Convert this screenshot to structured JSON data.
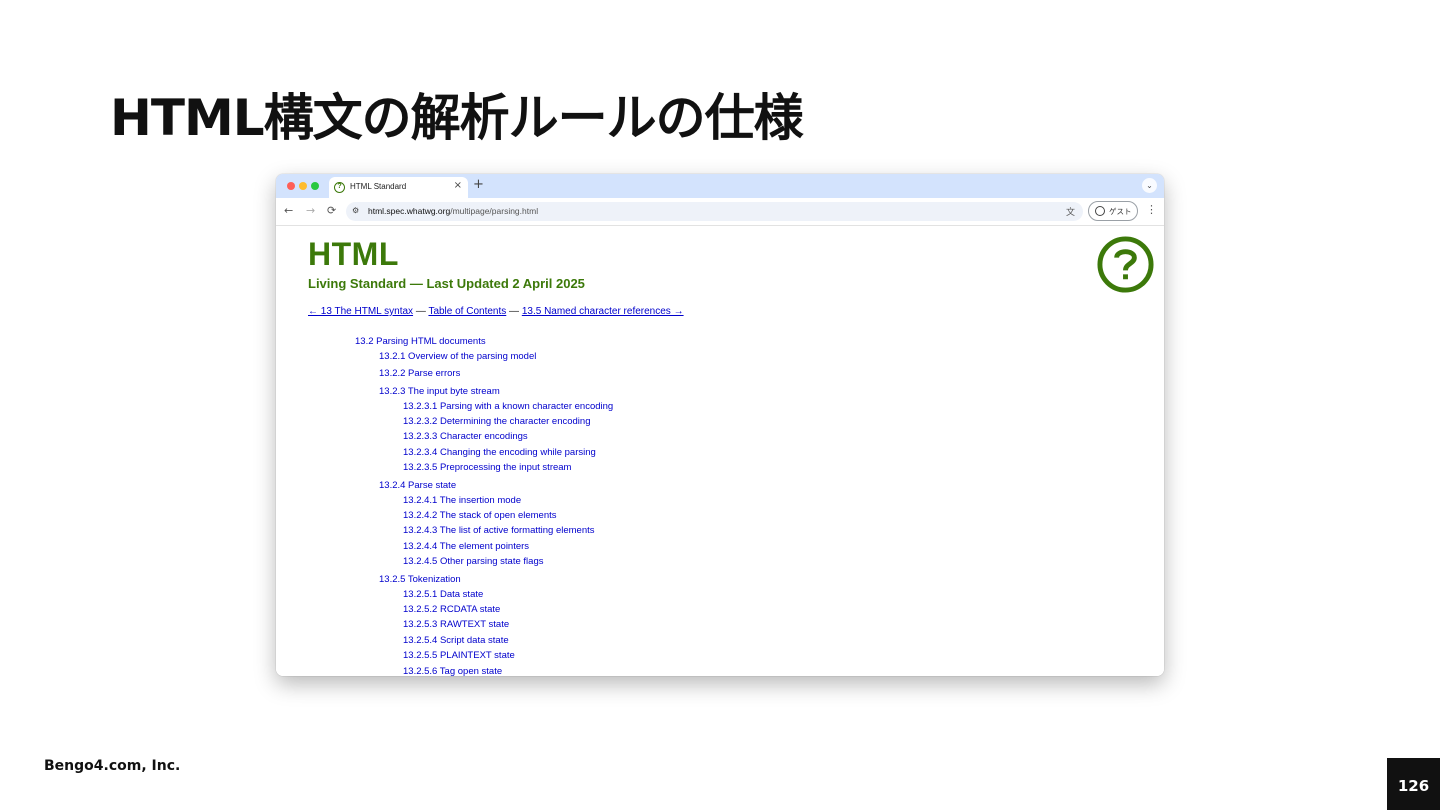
{
  "slide": {
    "title": "HTML構文の解析ルールの仕様",
    "footer": "Bengo4.com, Inc.",
    "page_number": "126"
  },
  "browser": {
    "tab_title": "HTML Standard",
    "tab_close": "×",
    "new_tab": "+",
    "tab_search_icon": "chevron-down-icon",
    "nav_back": "←",
    "nav_forward": "→",
    "nav_reload": "C",
    "site_info": "⚙",
    "url_host": "html.spec.whatwg.org",
    "url_path": "/multipage/parsing.html",
    "translate_icon": "文",
    "profile_label": "ゲスト",
    "menu": "⋮"
  },
  "page": {
    "title": "HTML",
    "subtitle": "Living Standard — Last Updated 2 April 2025",
    "breadcrumb": {
      "prev": "← 13 The HTML syntax",
      "sep1": " — ",
      "toc": "Table of Contents",
      "sep2": " — ",
      "next": "13.5 Named character references →"
    },
    "toc": [
      {
        "level": 0,
        "label": "13.2 Parsing HTML documents"
      },
      {
        "level": 1,
        "label": "13.2.1 Overview of the parsing model"
      },
      {
        "level": 1,
        "label": "13.2.2 Parse errors"
      },
      {
        "level": 1,
        "label": "13.2.3 The input byte stream"
      },
      {
        "level": 2,
        "label": "13.2.3.1 Parsing with a known character encoding"
      },
      {
        "level": 2,
        "label": "13.2.3.2 Determining the character encoding"
      },
      {
        "level": 2,
        "label": "13.2.3.3 Character encodings"
      },
      {
        "level": 2,
        "label": "13.2.3.4 Changing the encoding while parsing"
      },
      {
        "level": 2,
        "label": "13.2.3.5 Preprocessing the input stream"
      },
      {
        "level": 1,
        "label": "13.2.4 Parse state"
      },
      {
        "level": 2,
        "label": "13.2.4.1 The insertion mode"
      },
      {
        "level": 2,
        "label": "13.2.4.2 The stack of open elements"
      },
      {
        "level": 2,
        "label": "13.2.4.3 The list of active formatting elements"
      },
      {
        "level": 2,
        "label": "13.2.4.4 The element pointers"
      },
      {
        "level": 2,
        "label": "13.2.4.5 Other parsing state flags"
      },
      {
        "level": 1,
        "label": "13.2.5 Tokenization"
      },
      {
        "level": 2,
        "label": "13.2.5.1 Data state"
      },
      {
        "level": 2,
        "label": "13.2.5.2 RCDATA state"
      },
      {
        "level": 2,
        "label": "13.2.5.3 RAWTEXT state"
      },
      {
        "level": 2,
        "label": "13.2.5.4 Script data state"
      },
      {
        "level": 2,
        "label": "13.2.5.5 PLAINTEXT state"
      },
      {
        "level": 2,
        "label": "13.2.5.6 Tag open state"
      }
    ]
  },
  "colors": {
    "whatwg_green": "#3c790a",
    "link_blue": "#0000cc",
    "tabbar": "#d3e3fd"
  }
}
